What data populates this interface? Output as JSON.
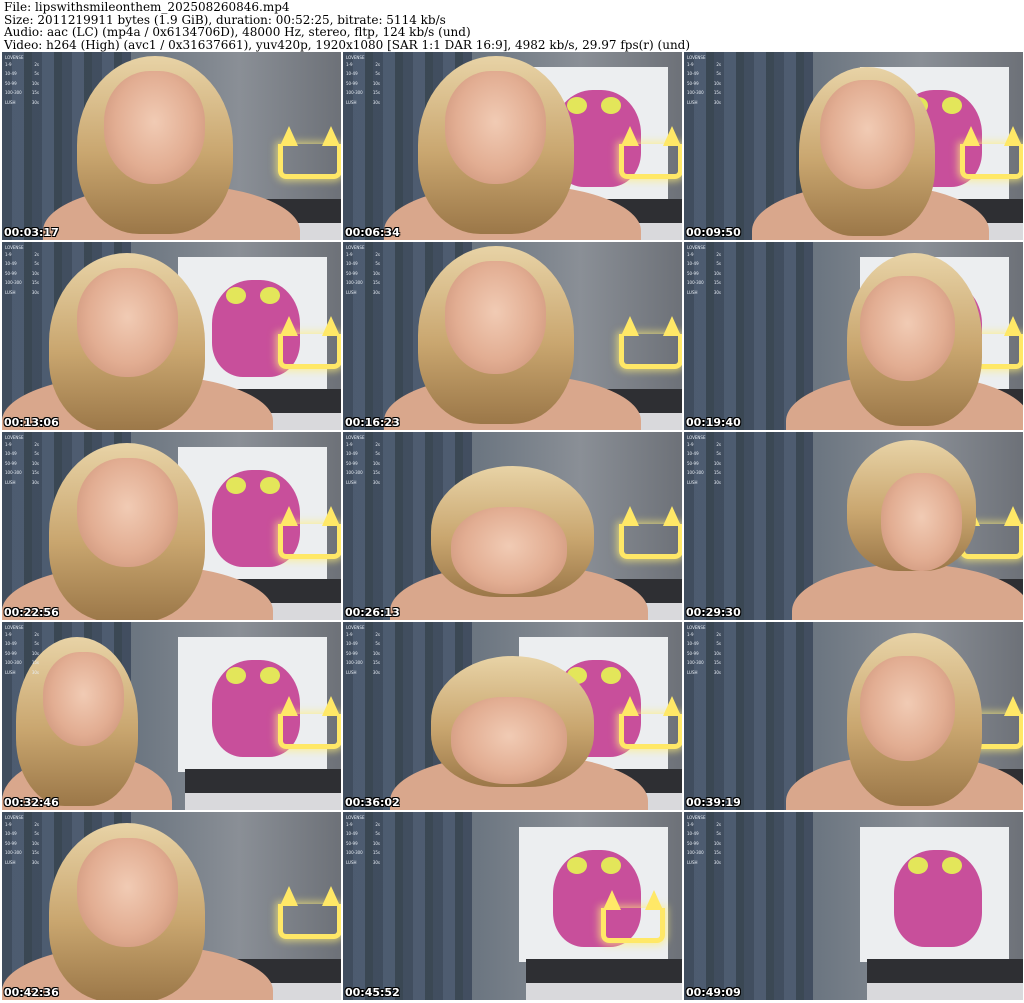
{
  "header": {
    "file_line": "File: lipswithsmileonthem_202508260846.mp4",
    "size_line": "Size: 2011219911 bytes (1.9 GiB), duration: 00:52:25, bitrate: 5114 kb/s",
    "audio_line": "Audio: aac (LC) (mp4a / 0x6134706D), 48000 Hz, stereo, fltp, 124 kb/s (und)",
    "video_line": "Video: h264 (High) (avc1 / 0x31637661), yuv420p, 1920x1080 [SAR 1:1 DAR 16:9], 4982 kb/s, 29.97 fps(r) (und)"
  },
  "overlay": {
    "title": "LOVENSE",
    "rows": [
      {
        "range": "1-9",
        "time": "2s"
      },
      {
        "range": "10-49",
        "time": "5s"
      },
      {
        "range": "50-99",
        "time": "10s"
      },
      {
        "range": "100-300",
        "time": "15s"
      },
      {
        "range": "LUSH",
        "time": "30s"
      }
    ]
  },
  "thumbnails": [
    {
      "timestamp": "00:03:17",
      "scene": "face-center",
      "crown": true,
      "pink": false
    },
    {
      "timestamp": "00:06:34",
      "scene": "face-center",
      "crown": true,
      "pink": true
    },
    {
      "timestamp": "00:09:50",
      "scene": "face-hand",
      "crown": true,
      "pink": true
    },
    {
      "timestamp": "00:13:06",
      "scene": "face-left",
      "crown": true,
      "pink": true
    },
    {
      "timestamp": "00:16:23",
      "scene": "face-center",
      "crown": true,
      "pink": false
    },
    {
      "timestamp": "00:19:40",
      "scene": "face-right",
      "crown": true,
      "pink": true
    },
    {
      "timestamp": "00:22:56",
      "scene": "face-left",
      "crown": true,
      "pink": true
    },
    {
      "timestamp": "00:26:13",
      "scene": "face-down",
      "crown": true,
      "pink": false
    },
    {
      "timestamp": "00:29:30",
      "scene": "profile",
      "crown": true,
      "pink": false
    },
    {
      "timestamp": "00:32:46",
      "scene": "face-left-small",
      "crown": true,
      "pink": true
    },
    {
      "timestamp": "00:36:02",
      "scene": "face-down",
      "crown": true,
      "pink": true
    },
    {
      "timestamp": "00:39:19",
      "scene": "face-right",
      "crown": true,
      "pink": false
    },
    {
      "timestamp": "00:42:36",
      "scene": "face-left",
      "crown": true,
      "pink": false
    },
    {
      "timestamp": "00:45:52",
      "scene": "empty-room",
      "crown": true,
      "pink": true
    },
    {
      "timestamp": "00:49:09",
      "scene": "empty-room",
      "crown": false,
      "pink": true
    }
  ]
}
